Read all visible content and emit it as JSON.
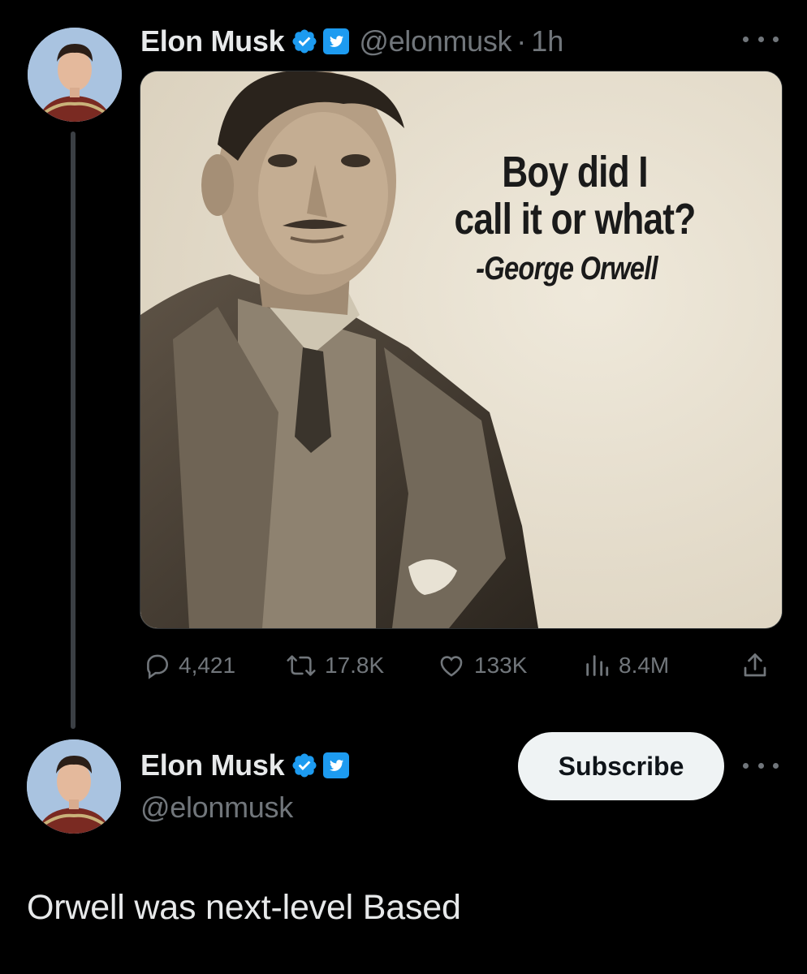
{
  "first_tweet": {
    "author": {
      "name": "Elon Musk",
      "handle": "@elonmusk",
      "time": "1h",
      "separator": "·"
    },
    "media": {
      "quote_lines": [
        "Boy did I",
        "call it or what?"
      ],
      "attribution": "-George Orwell"
    },
    "actions": {
      "replies": "4,421",
      "retweets": "17.8K",
      "likes": "133K",
      "views": "8.4M"
    }
  },
  "second_tweet": {
    "author": {
      "name": "Elon Musk",
      "handle": "@elonmusk"
    },
    "subscribe_label": "Subscribe",
    "text": "Orwell was next-level Based"
  },
  "colors": {
    "background": "#000000",
    "primary_text": "#e7e9ea",
    "secondary_text": "#71767b",
    "verified_blue": "#1d9bf0",
    "subscribe_bg": "#eff3f4"
  },
  "icons": [
    "verified-badge-icon",
    "twitter-bird-badge-icon",
    "more-icon",
    "reply-icon",
    "retweet-icon",
    "like-icon",
    "views-icon",
    "share-icon"
  ]
}
